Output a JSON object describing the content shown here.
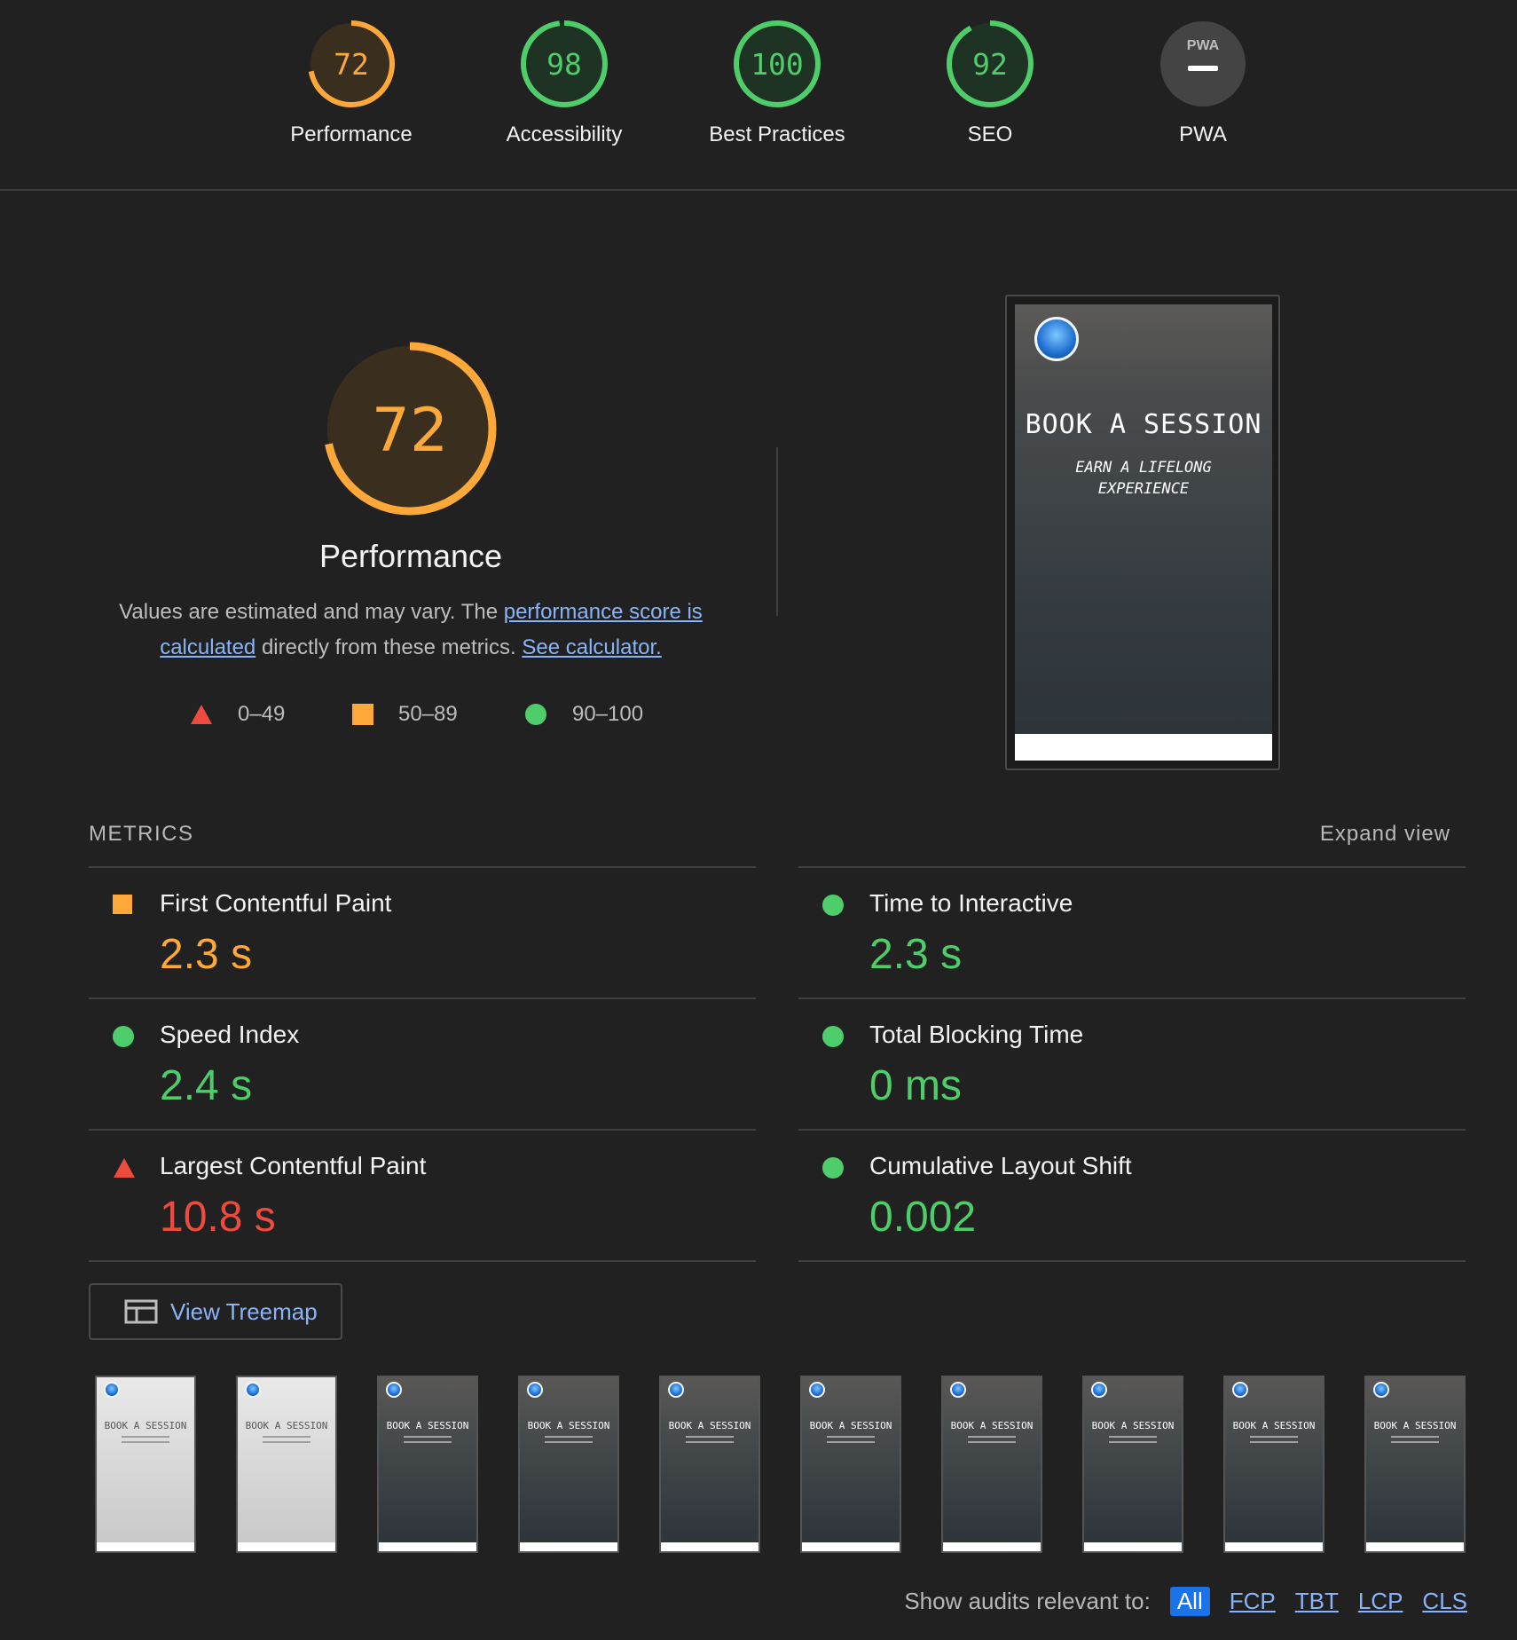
{
  "scores": [
    {
      "value": "72",
      "label": "Performance",
      "fraction": 0.72,
      "status": "average"
    },
    {
      "value": "98",
      "label": "Accessibility",
      "fraction": 0.98,
      "status": "pass"
    },
    {
      "value": "100",
      "label": "Best Practices",
      "fraction": 1.0,
      "status": "pass"
    },
    {
      "value": "92",
      "label": "SEO",
      "fraction": 0.92,
      "status": "pass"
    },
    {
      "value": "",
      "label": "PWA",
      "badge": "PWA",
      "status": "na"
    }
  ],
  "performance": {
    "score": "72",
    "fraction": 0.72,
    "title": "Performance",
    "description_pre": "Values are estimated and may vary. The ",
    "link_score": "performance score is calculated",
    "description_mid": " directly from these metrics. ",
    "link_calculator": "See calculator."
  },
  "legend": [
    {
      "shape": "triangle",
      "range": "0–49"
    },
    {
      "shape": "square",
      "range": "50–89"
    },
    {
      "shape": "circle",
      "range": "90–100"
    }
  ],
  "screenshot": {
    "title": "BOOK A SESSION",
    "subtitle": "EARN A LIFELONG EXPERIENCE"
  },
  "metrics": {
    "heading": "METRICS",
    "expand_label": "Expand view",
    "items": [
      {
        "title": "First Contentful Paint",
        "value": "2.3 s",
        "status": "average"
      },
      {
        "title": "Time to Interactive",
        "value": "2.3 s",
        "status": "pass"
      },
      {
        "title": "Speed Index",
        "value": "2.4 s",
        "status": "pass"
      },
      {
        "title": "Total Blocking Time",
        "value": "0 ms",
        "status": "pass"
      },
      {
        "title": "Largest Contentful Paint",
        "value": "10.8 s",
        "status": "fail"
      },
      {
        "title": "Cumulative Layout Shift",
        "value": "0.002",
        "status": "pass"
      }
    ]
  },
  "treemap_button": "View Treemap",
  "filmstrip": {
    "frame_title": "BOOK A SESSION",
    "frames": [
      "light",
      "light",
      "dark",
      "dark",
      "dark",
      "dark",
      "dark",
      "dark",
      "dark",
      "dark"
    ]
  },
  "audit_filter": {
    "label": "Show audits relevant to:",
    "options": [
      "All",
      "FCP",
      "TBT",
      "LCP",
      "CLS"
    ],
    "active": "All"
  },
  "colors": {
    "background": "#212121",
    "pass": "#4fcd6b",
    "average": "#ffa83a",
    "fail": "#ee4b3f",
    "link": "#8ab4f8",
    "active_chip": "#1a73e8"
  },
  "icons": {
    "fail": "triangle-icon",
    "average": "square-icon",
    "pass": "circle-icon",
    "treemap": "treemap-icon",
    "pwa": "pwa-icon"
  }
}
